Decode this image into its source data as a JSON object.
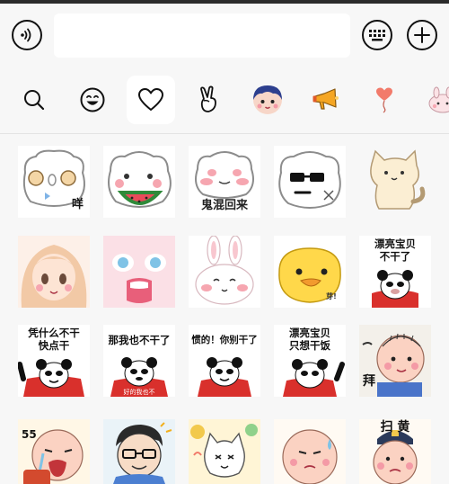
{
  "input_bar": {
    "voice_icon": "voice-wave-icon",
    "text_value": "",
    "keyboard_icon": "keyboard-icon",
    "more_icon": "plus-icon"
  },
  "emoji_tabs": [
    {
      "name": "search",
      "icon": "search-icon"
    },
    {
      "name": "emoji",
      "icon": "smiley-icon"
    },
    {
      "name": "favorites",
      "icon": "heart-icon",
      "active": true
    },
    {
      "name": "gesture",
      "icon": "peace-hand-icon"
    },
    {
      "name": "avatar-pack",
      "icon": "boy-avatar-icon"
    },
    {
      "name": "megaphone-pack",
      "icon": "megaphone-icon"
    },
    {
      "name": "heart-balloon-pack",
      "icon": "heart-balloon-icon"
    },
    {
      "name": "bunny-pack",
      "icon": "pink-bunny-icon"
    }
  ],
  "stickers": {
    "row1": {
      "s2": "",
      "s3": "鬼混回来"
    },
    "row2": {
      "s5": "漂亮宝贝\n不干了",
      "s4_small": "芽!"
    },
    "row3": {
      "s1": "凭什么不干\n快点干",
      "s2": "那我也不干了",
      "s2_small": "好的我也不",
      "s3": "惯的！你别干了",
      "s4": "漂亮宝贝\n只想干饭",
      "s5": "拜"
    },
    "row4": {
      "s1": "55",
      "s5": "扫 黄"
    }
  },
  "colors": {
    "background": "#f7f7f7",
    "tile": "#ffffff",
    "panda_red": "#d9302c",
    "blush": "#f6a6b0"
  }
}
